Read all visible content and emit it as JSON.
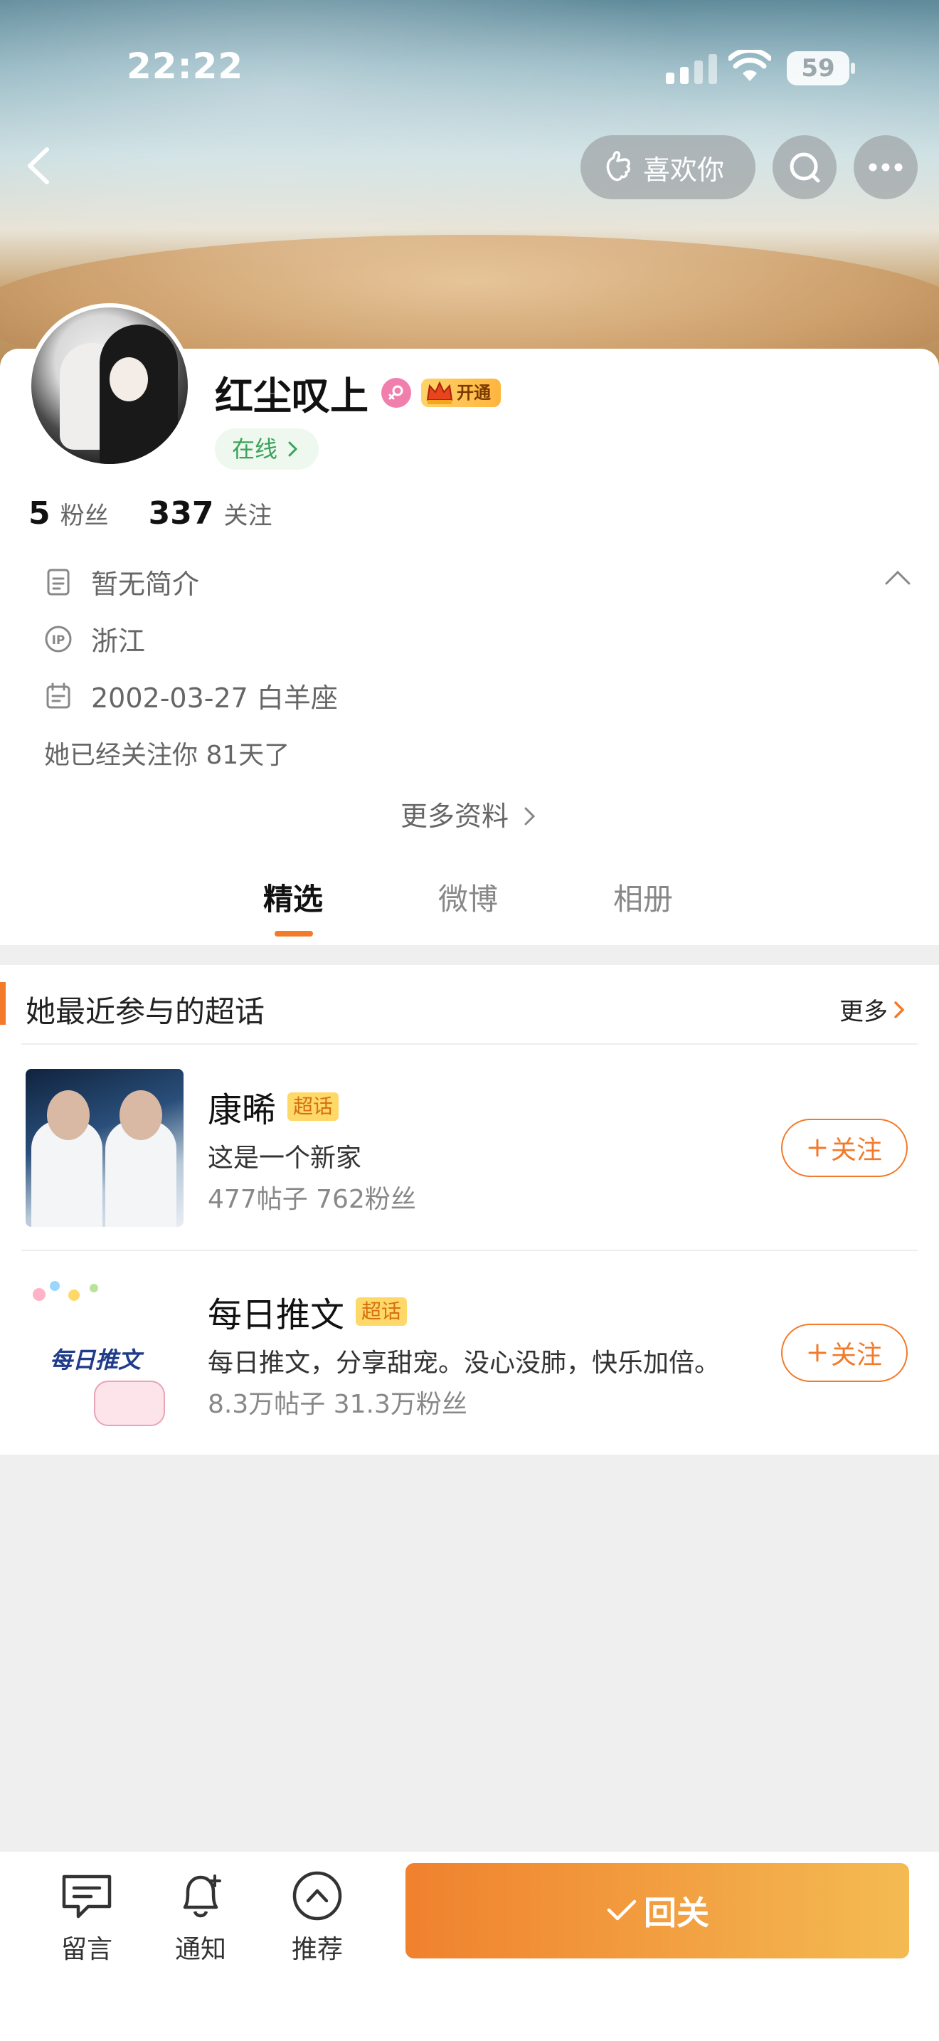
{
  "status_bar": {
    "time": "22:22",
    "battery": "59"
  },
  "header": {
    "like_label": "喜欢你"
  },
  "profile": {
    "name": "红尘叹上",
    "vip_label": "开通",
    "online_label": "在线",
    "fans_count": "5",
    "fans_label": "粉丝",
    "following_count": "337",
    "following_label": "关注",
    "bio": "暂无简介",
    "ip_location": "浙江",
    "birthday": "2002-03-27 白羊座",
    "follow_days_text": "她已经关注你 81天了",
    "more_info_label": "更多资料"
  },
  "tabs": [
    {
      "label": "精选",
      "active": true
    },
    {
      "label": "微博",
      "active": false
    },
    {
      "label": "相册",
      "active": false
    }
  ],
  "topics": {
    "title": "她最近参与的超话",
    "more_label": "更多",
    "items": [
      {
        "name": "康晞",
        "tag": "超话",
        "desc": "这是一个新家",
        "stats": "477帖子 762粉丝",
        "follow_label": "关注"
      },
      {
        "name": "每日推文",
        "tag": "超话",
        "desc": "每日推文，分享甜宠。没心没肺，快乐加倍。",
        "stats": "8.3万帖子 31.3万粉丝",
        "follow_label": "关注"
      }
    ],
    "thumb2_text": "每日推文"
  },
  "bottom_bar": {
    "message_label": "留言",
    "notify_label": "通知",
    "recommend_label": "推荐",
    "followback_label": "回关"
  },
  "colors": {
    "accent": "#f37a2a",
    "online_green": "#3aa35a",
    "super_tag_bg": "#ffd86a"
  }
}
